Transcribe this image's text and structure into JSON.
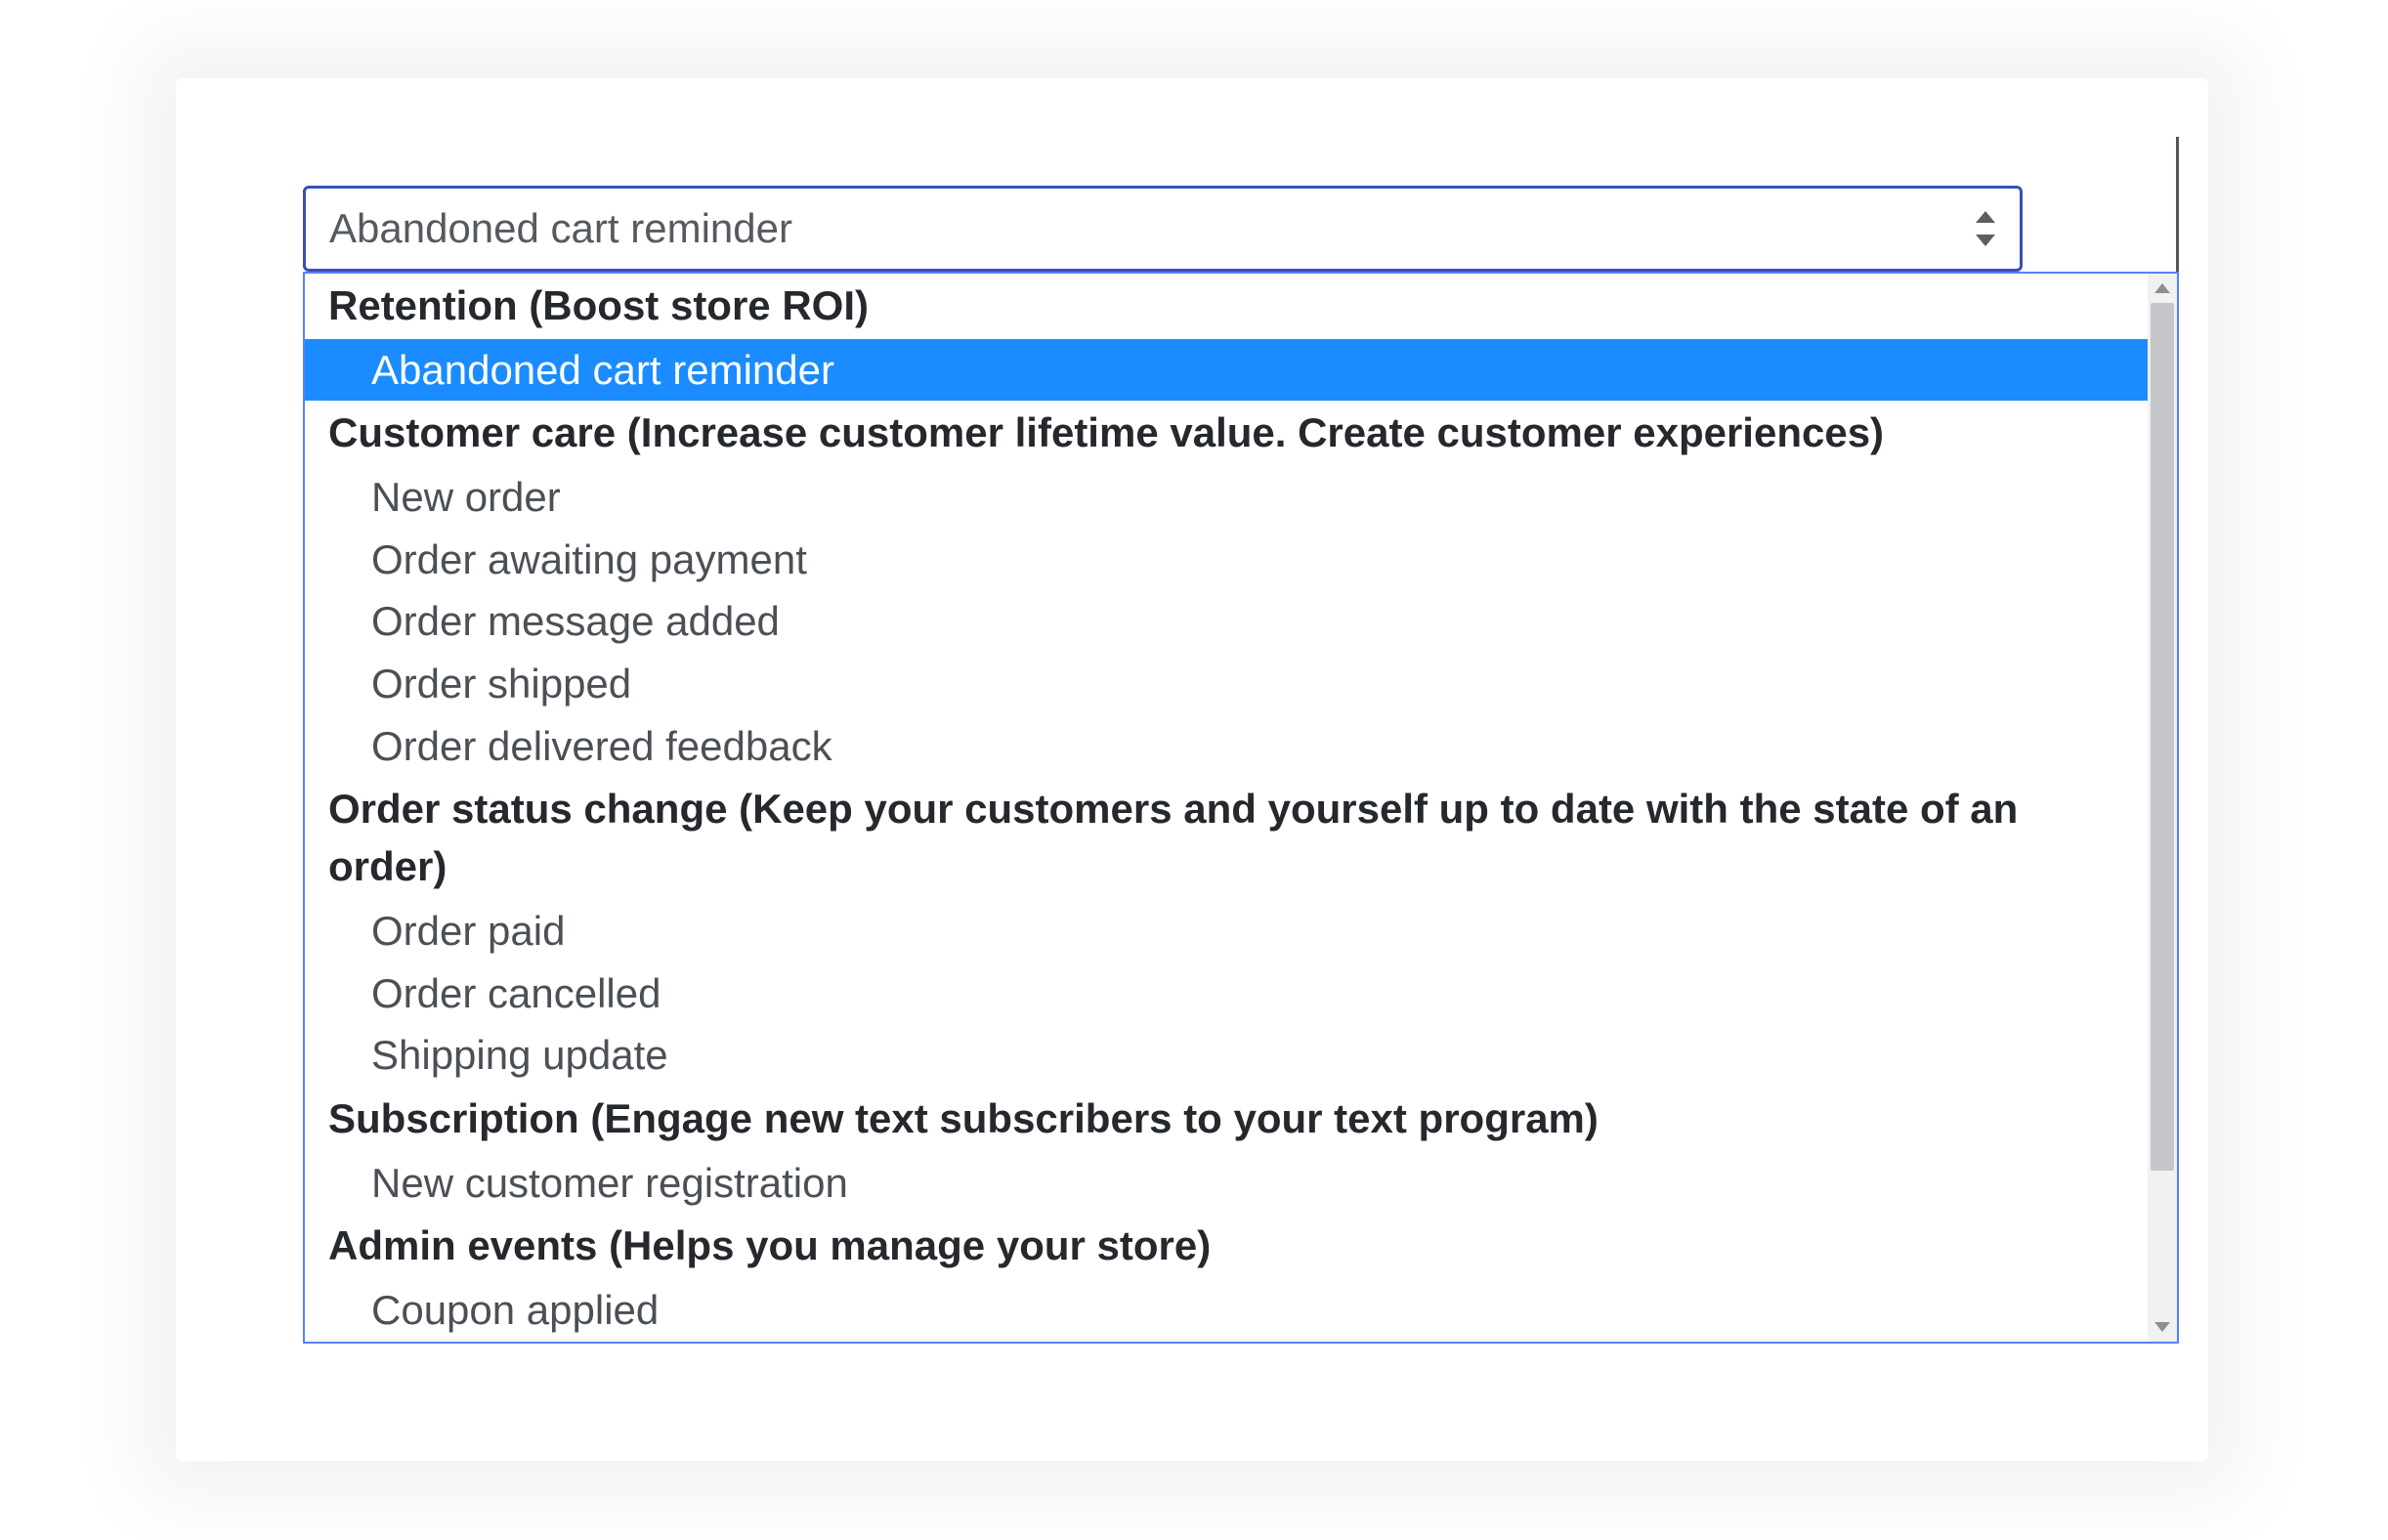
{
  "select": {
    "current_value": "Abandoned cart reminder"
  },
  "dropdown": {
    "groups": [
      {
        "header": "Retention (Boost store ROI)",
        "options": [
          {
            "label": "Abandoned cart reminder",
            "selected": true
          }
        ]
      },
      {
        "header": "Customer care (Increase customer lifetime value. Create customer experiences)",
        "options": [
          {
            "label": "New order",
            "selected": false
          },
          {
            "label": "Order awaiting payment",
            "selected": false
          },
          {
            "label": "Order message added",
            "selected": false
          },
          {
            "label": "Order shipped",
            "selected": false
          },
          {
            "label": "Order delivered feedback",
            "selected": false
          }
        ]
      },
      {
        "header": "Order status change (Keep your customers and yourself up to date with the state of an order)",
        "options": [
          {
            "label": "Order paid",
            "selected": false
          },
          {
            "label": "Order cancelled",
            "selected": false
          },
          {
            "label": "Shipping update",
            "selected": false
          }
        ]
      },
      {
        "header": "Subscription (Engage new text subscribers to your text program)",
        "options": [
          {
            "label": "New customer registration",
            "selected": false
          }
        ]
      },
      {
        "header": "Admin events (Helps you manage your store)",
        "options": [
          {
            "label": "Coupon applied",
            "selected": false
          }
        ]
      }
    ]
  }
}
